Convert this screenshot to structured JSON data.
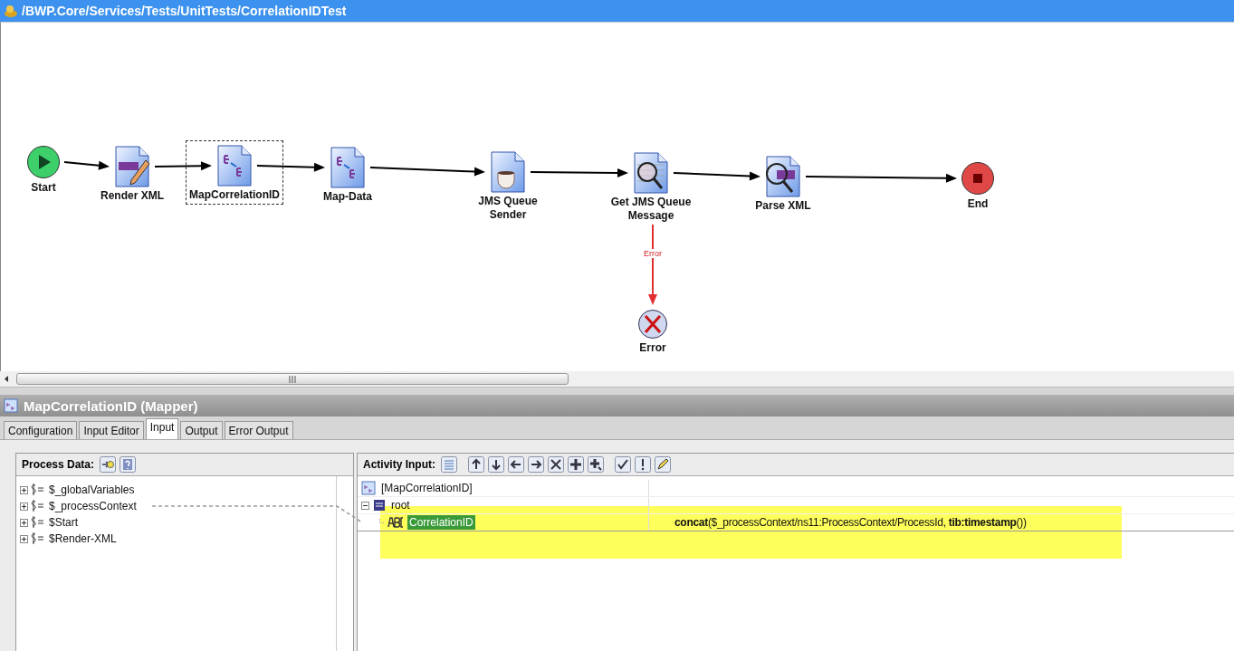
{
  "window": {
    "title": "/BWP.Core/Services/Tests/UnitTests/CorrelationIDTest"
  },
  "diagram": {
    "nodes": [
      {
        "label": "Start",
        "kind": "start",
        "selected": false
      },
      {
        "label": "Render XML",
        "kind": "render-xml",
        "selected": false
      },
      {
        "label": "MapCorrelationID",
        "kind": "mapper",
        "selected": true
      },
      {
        "label": "Map-Data",
        "kind": "mapper",
        "selected": false
      },
      {
        "label": "JMS Queue Sender",
        "kind": "jms-sender",
        "selected": false
      },
      {
        "label": "Get JMS Queue Message",
        "kind": "jms-get",
        "selected": false
      },
      {
        "label": "Parse XML",
        "kind": "parse-xml",
        "selected": false
      },
      {
        "label": "End",
        "kind": "end",
        "selected": false
      },
      {
        "label": "Error",
        "kind": "error",
        "selected": false
      }
    ],
    "transitions": [
      {
        "kind": "normal"
      },
      {
        "kind": "normal"
      },
      {
        "kind": "normal"
      },
      {
        "kind": "normal"
      },
      {
        "kind": "normal"
      },
      {
        "kind": "normal"
      },
      {
        "kind": "normal"
      },
      {
        "kind": "error",
        "label": "Error"
      }
    ]
  },
  "panel": {
    "title": "MapCorrelationID (Mapper)",
    "tabs": [
      {
        "label": "Configuration",
        "selected": false
      },
      {
        "label": "Input Editor",
        "selected": false
      },
      {
        "label": "Input",
        "selected": true
      },
      {
        "label": "Output",
        "selected": false
      },
      {
        "label": "Error Output",
        "selected": false
      }
    ],
    "process_data": {
      "title": "Process Data:",
      "items": [
        {
          "label": "$_globalVariables",
          "expanded": false
        },
        {
          "label": "$_processContext",
          "expanded": false
        },
        {
          "label": "$Start",
          "expanded": false
        },
        {
          "label": "$Render-XML",
          "expanded": false
        }
      ]
    },
    "activity_input": {
      "title": "Activity Input:",
      "tree": [
        {
          "label": "[MapCorrelationID]",
          "kind": "activity"
        },
        {
          "label": "root",
          "kind": "element",
          "expanded": true,
          "children": [
            {
              "label": "CorrelationID",
              "kind": "string",
              "selected": true,
              "expression": "**concat**($_processContext/ns11:ProcessContext/ProcessId, **tib:timestamp**())"
            }
          ]
        }
      ]
    }
  }
}
